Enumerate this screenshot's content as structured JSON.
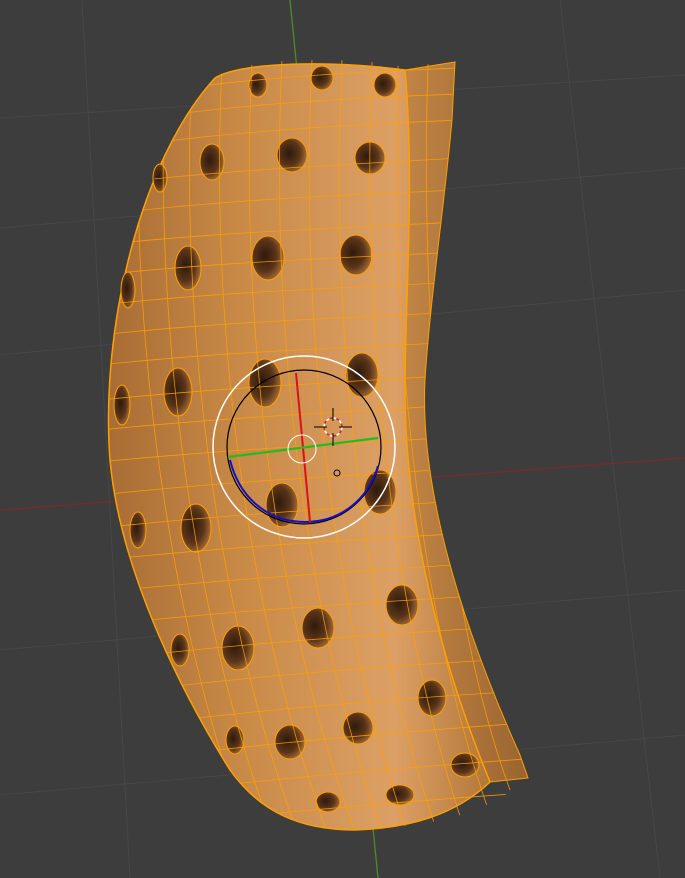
{
  "viewport": {
    "background": "#3d3d3d",
    "grid_color": "#474747",
    "axis_x_color": "#7a2a2a",
    "axis_y_color": "#4d8a2a"
  },
  "mesh": {
    "object": "curved-perforated-panel",
    "mode": "edit-wireframe-selected",
    "fill_color": "#c98a47",
    "wire_color": "#ffa000",
    "hole_color": "#5a3418"
  },
  "gizmo": {
    "type": "rotate-trackball",
    "x_axis_color": "#dd1111",
    "y_axis_color": "#22bb22",
    "z_axis_color": "#1111cc",
    "outer_ring_color": "#ffffff",
    "inner_ring_color": "#000000"
  },
  "cursor_3d": {
    "icon": "3d-cursor-icon"
  }
}
